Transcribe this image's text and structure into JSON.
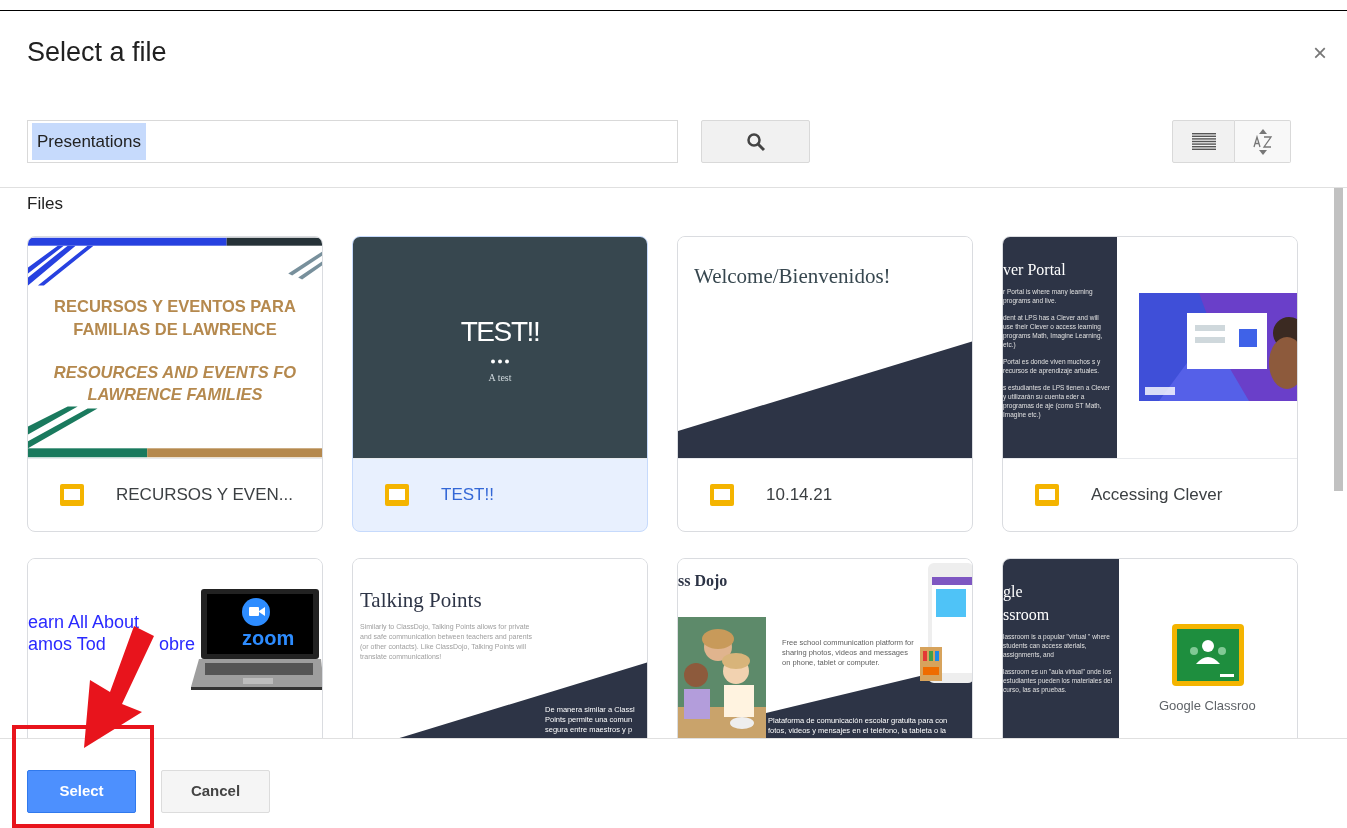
{
  "dialog": {
    "title": "Select a file",
    "close": "×"
  },
  "search": {
    "value": "Presentations",
    "highlighted": true
  },
  "section_label": "Files",
  "files": [
    {
      "name": "RECURSOS Y EVEN...",
      "selected": false,
      "thumbnail": {
        "kind": "banner",
        "lines": [
          {
            "text": "RECURSOS Y EVENTOS PARA",
            "italic": false
          },
          {
            "text": "FAMILIAS DE LAWRENCE",
            "italic": false
          },
          {
            "text": "RESOURCES AND EVENTS FO",
            "italic": true
          },
          {
            "text": "LAWRENCE FAMILIES",
            "italic": true
          }
        ]
      }
    },
    {
      "name": "TEST!!",
      "selected": true,
      "thumbnail": {
        "kind": "dark",
        "title": "TEST!!",
        "subtitle": "A test"
      }
    },
    {
      "name": "10.14.21",
      "selected": false,
      "thumbnail": {
        "kind": "diagonal",
        "title": "Welcome/Bienvenidos!"
      }
    },
    {
      "name": "Accessing Clever",
      "selected": false,
      "thumbnail": {
        "kind": "sidebar",
        "title_lines": [
          "ver Portal"
        ],
        "paragraphs": [
          "r Portal is where many learning programs and live.",
          "dent at LPS has a Clever and will use their Clever o access learning programs Math, Imagine Learning, etc.)",
          "Portal es donde viven muchos s y recursos de aprendizaje artuales.",
          "s estudiantes de LPS tienen a Clever y utilizarán su cuenta eder a programas de aje (como ST Math, Imagine etc.)"
        ]
      }
    },
    {
      "selected": false,
      "thumbnail": {
        "kind": "zoom",
        "lines": [
          "earn All About",
          "amos Tod"
        ],
        "line_tail": "obre",
        "logo": "zoom"
      }
    },
    {
      "selected": false,
      "thumbnail": {
        "kind": "talking",
        "title": "Talking Points",
        "paragraph": "Similarly to ClassDojo, Talking Points allows for private and safe communication between teachers and parents (or other contacts). Like ClassDojo, Talking Points will translate communications!",
        "dark_lines": [
          "De manera similar a Classl",
          "Points permite una comun",
          "segura entre maestros y p"
        ]
      }
    },
    {
      "selected": false,
      "thumbnail": {
        "kind": "dojo",
        "title": "ss Dojo",
        "paragraph": "Free school communication platform for sharing photos, videos and messages on phone, tablet or computer.",
        "dark_lines": [
          "Plataforma de comunicación escolar gratuita para con",
          "fotos, videos y mensajes en el teléfono, la tableta o la"
        ]
      }
    },
    {
      "selected": false,
      "thumbnail": {
        "kind": "classroom",
        "title_lines": [
          "gle",
          "ssroom"
        ],
        "paragraphs": [
          "lassroom is a popular \"virtual \" where students can access aterials, assignments, and",
          "lassroom es un \"aula virtual\" onde los estudiantes pueden los materiales del curso, las as pruebas."
        ],
        "logo_text": "Google Classroo"
      }
    }
  ],
  "footer": {
    "buttons": [
      {
        "label": "Select",
        "kind": "primary"
      },
      {
        "label": "Cancel",
        "kind": "secondary"
      }
    ]
  }
}
